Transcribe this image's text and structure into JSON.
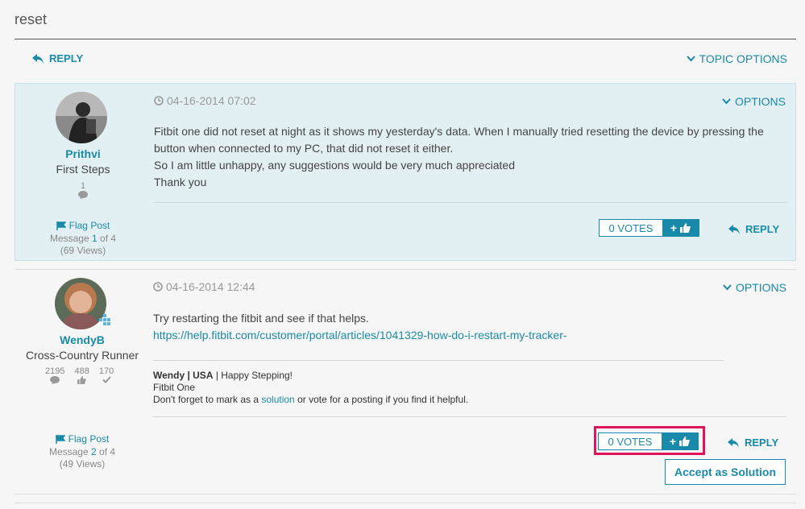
{
  "page": {
    "title": "reset"
  },
  "toolbar": {
    "reply_label": "REPLY",
    "topic_options_label": "TOPIC OPTIONS"
  },
  "posts": [
    {
      "author": {
        "name": "Prithvi",
        "rank": "First Steps",
        "stat_messages": "1"
      },
      "flag_label": "Flag Post",
      "message_prefix": "Message",
      "message_number": "1",
      "message_suffix": "of 4",
      "views": "(69 Views)",
      "date": "04-16-2014 07:02",
      "options_label": "OPTIONS",
      "body_lines": [
        "Fitbit one did not reset at night as it shows my yesterday's data. When I manually tried resetting the device by pressing the",
        "button when connected to my PC, that did not reset it either.",
        "So I am little unhappy, any suggestions would be very much appreciated",
        "Thank you"
      ],
      "votes_label": "0 VOTES",
      "reply_label": "REPLY"
    },
    {
      "author": {
        "name": "WendyB",
        "rank": "Cross-Country Runner",
        "stat_messages": "2195",
        "stat_kudos": "488",
        "stat_solutions": "170"
      },
      "flag_label": "Flag Post",
      "message_prefix": "Message",
      "message_number": "2",
      "message_suffix": "of 4",
      "views": "(49 Views)",
      "date": "04-16-2014 12:44",
      "options_label": "OPTIONS",
      "body_line1": "Try restarting the fitbit and see if that helps.",
      "body_link": "https://help.fitbit.com/customer/portal/articles/1041329-how-do-i-restart-my-tracker-",
      "signature": {
        "name_bold": "Wendy | USA",
        "name_rest": " | Happy Stepping!",
        "device": "Fitbit One",
        "note_pre": "Don't forget to mark as a ",
        "note_link": "solution",
        "note_post": " or vote for a posting if you find it helpful."
      },
      "votes_label": "0 VOTES",
      "reply_label": "REPLY",
      "accept_label": "Accept as Solution"
    }
  ],
  "colors": {
    "accent": "#1a8aaa",
    "highlight": "#e0145a",
    "post1_bg": "#e2f0f4"
  }
}
